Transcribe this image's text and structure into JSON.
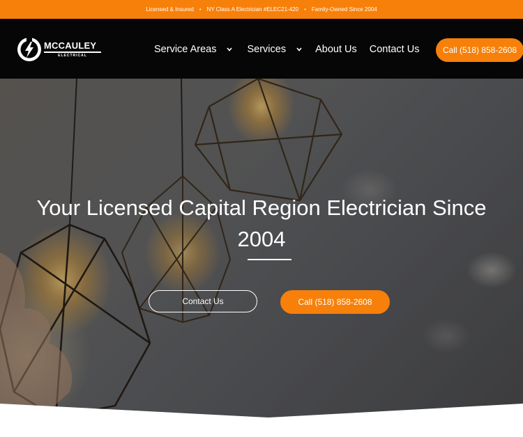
{
  "topbar": {
    "items": [
      "Licensed & Insured",
      "NY Class A Electrician #ELEC21-420",
      "Family-Owned Since 2004"
    ],
    "separator": "•"
  },
  "brand": {
    "name": "MCCAULEY",
    "sub": "ELECTRICAL"
  },
  "nav": {
    "items": [
      {
        "label": "Service Areas",
        "has_dropdown": true
      },
      {
        "label": "Services",
        "has_dropdown": true
      },
      {
        "label": "About Us",
        "has_dropdown": false
      },
      {
        "label": "Contact Us",
        "has_dropdown": false
      }
    ],
    "call_label": "Call (518) 858-2608"
  },
  "hero": {
    "title": "Your Licensed Capital Region Electrician Since 2004",
    "contact_label": "Contact Us",
    "call_label": "Call (518) 858-2608"
  },
  "colors": {
    "accent": "#f7800a",
    "nav_bg": "#060606",
    "text_light": "#ffffff"
  },
  "icons": {
    "logo": "lightning-bolt-circle-icon",
    "dropdown": "chevron-down-icon"
  }
}
